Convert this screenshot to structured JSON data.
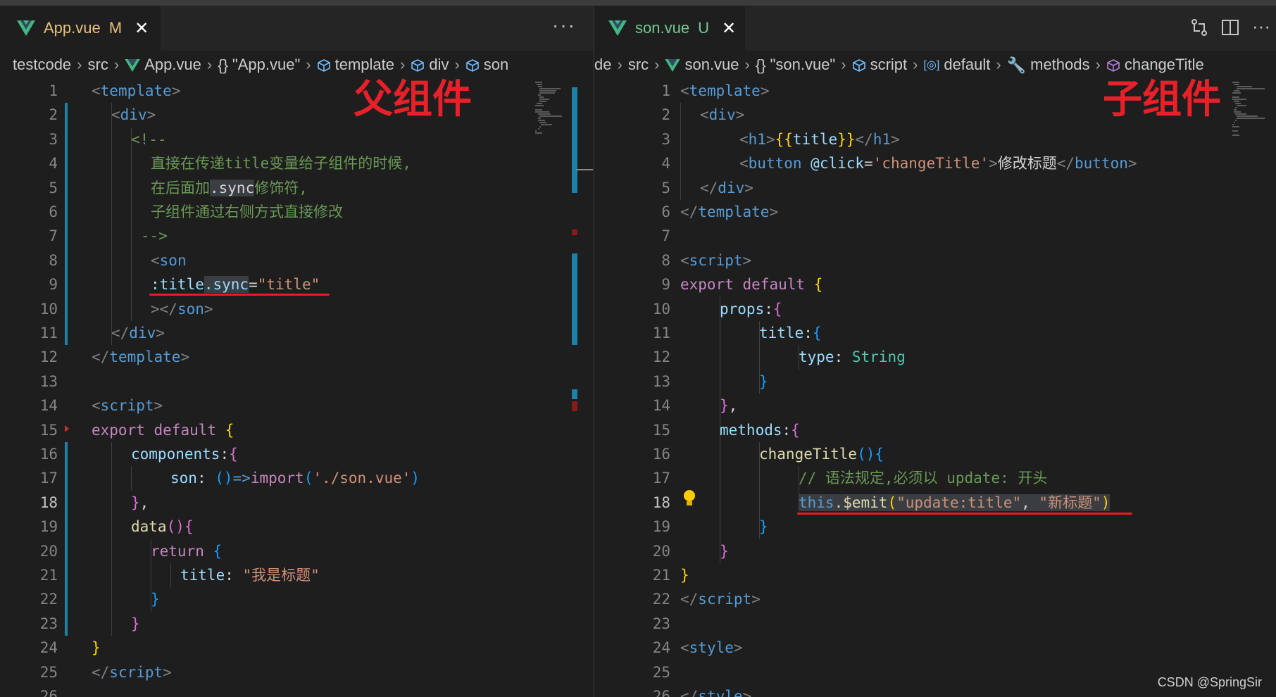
{
  "left": {
    "tab": {
      "name": "App.vue",
      "status": "M"
    },
    "more": "···",
    "breadcrumbs": [
      "testcode",
      "src",
      "App.vue",
      "\"App.vue\"",
      "template",
      "div",
      "son"
    ],
    "annotation": "父组件",
    "lines": [
      [
        "<",
        "template",
        ">"
      ],
      [
        "<",
        "div",
        ">"
      ],
      [
        "<!--"
      ],
      [
        "直接在传递title变量给子组件的时候,"
      ],
      [
        "在后面加",
        ".sync",
        "修饰符,"
      ],
      [
        "子组件通过右侧方式直接修改"
      ],
      [
        "-->"
      ],
      [
        "<",
        "son"
      ],
      [
        ":title",
        ".sync",
        "=",
        "\"title\""
      ],
      [
        ">",
        "</",
        "son",
        ">"
      ],
      [
        "</",
        "div",
        ">"
      ],
      [
        "</",
        "template",
        ">"
      ],
      [],
      [
        "<",
        "script",
        ">"
      ],
      [
        "export",
        "default",
        "{"
      ],
      [
        "components",
        ":",
        "{"
      ],
      [
        "son",
        ": ",
        "()",
        "=>",
        "import",
        "(",
        "'./son.vue'",
        ")"
      ],
      [
        "}",
        ","
      ],
      [
        "data",
        "()",
        "{"
      ],
      [
        "return",
        "{"
      ],
      [
        "title",
        ": ",
        "\"我是标题\""
      ],
      [
        "}"
      ],
      [
        "}"
      ],
      [
        "}"
      ],
      [
        "</",
        "script",
        ">"
      ],
      []
    ]
  },
  "right": {
    "tab": {
      "name": "son.vue",
      "status": "U"
    },
    "breadcrumbs": [
      "de",
      "src",
      "son.vue",
      "\"son.vue\"",
      "script",
      "default",
      "methods",
      "changeTitle"
    ],
    "annotation": "子组件",
    "lines": [
      [
        "<",
        "template",
        ">"
      ],
      [
        "<",
        "div",
        ">"
      ],
      [
        "<",
        "h1",
        ">",
        "{{",
        "title",
        "}}",
        "</",
        "h1",
        ">"
      ],
      [
        "<",
        "button",
        " ",
        "@click",
        "=",
        "'changeTitle'",
        ">",
        "修改标题",
        "</",
        "button",
        ">"
      ],
      [
        "</",
        "div",
        ">"
      ],
      [
        "</",
        "template",
        ">"
      ],
      [],
      [
        "<",
        "script",
        ">"
      ],
      [
        "export",
        "default",
        "{"
      ],
      [
        "props",
        ":",
        "{"
      ],
      [
        "title",
        ":",
        "{"
      ],
      [
        "type",
        ": ",
        "String"
      ],
      [
        "}"
      ],
      [
        "}",
        ","
      ],
      [
        "methods",
        ":",
        "{"
      ],
      [
        "changeTitle",
        "()",
        "{"
      ],
      [
        "// 语法规定,必须以 update: 开头"
      ],
      [
        "this",
        ".",
        "$emit",
        "(",
        "\"update:title\"",
        ", ",
        "\"新标题\"",
        ")"
      ],
      [
        "}"
      ],
      [
        "}"
      ],
      [
        "}"
      ],
      [
        "</",
        "script",
        ">"
      ],
      [],
      [
        "<",
        "style",
        ">"
      ],
      [],
      [
        "</",
        "style",
        ">"
      ]
    ]
  },
  "current_line": 18,
  "watermark": "CSDN @SpringSir",
  "colors": {
    "red_annotation": "#e8202a",
    "vue_green": "#41b883",
    "modified_tab": "#e5c07b"
  }
}
